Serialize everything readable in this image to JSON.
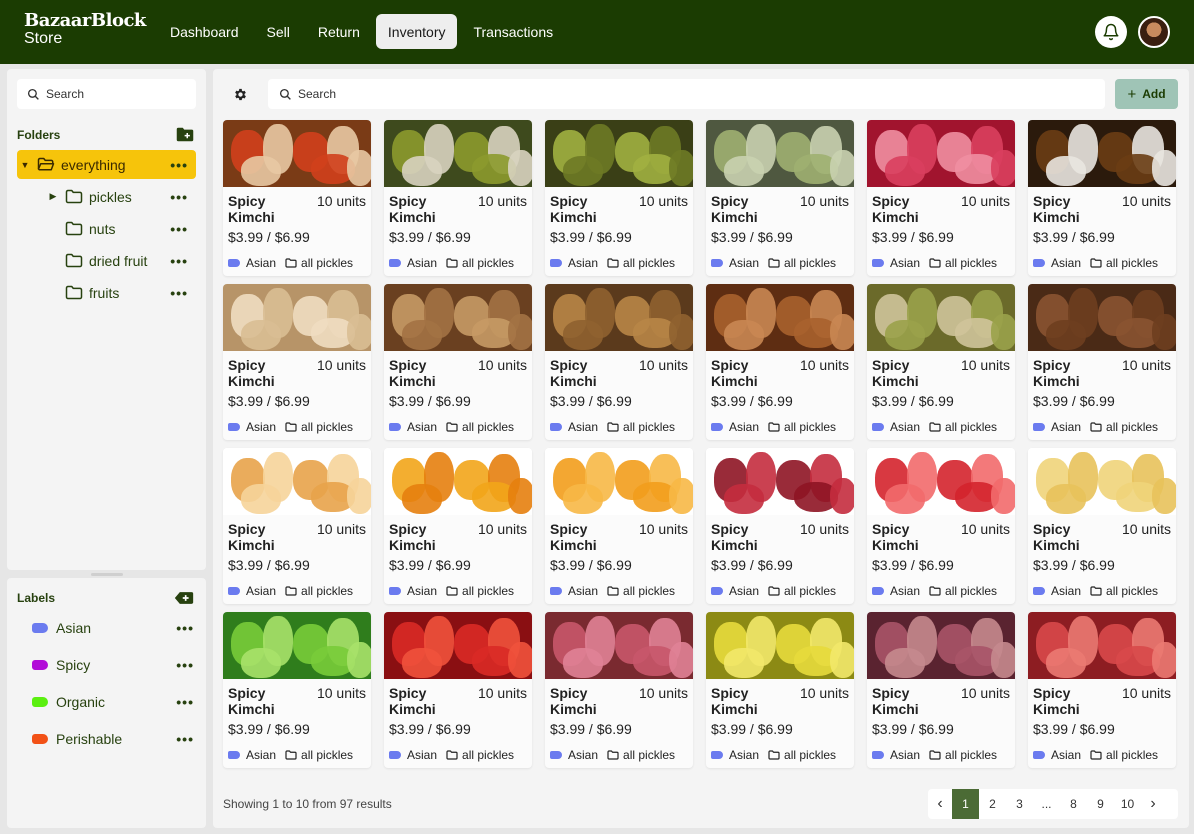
{
  "brand": {
    "line1": "BazaarBlock",
    "line2": "Store"
  },
  "nav": [
    {
      "label": "Dashboard",
      "active": false
    },
    {
      "label": "Sell",
      "active": false
    },
    {
      "label": "Return",
      "active": false
    },
    {
      "label": "Inventory",
      "active": true
    },
    {
      "label": "Transactions",
      "active": false
    }
  ],
  "sidebar": {
    "search_placeholder": "Search",
    "folders_title": "Folders",
    "folders": [
      {
        "label": "everything",
        "active": true,
        "caret": "▼"
      },
      {
        "label": "pickles",
        "active": false,
        "caret": "▶"
      },
      {
        "label": "nuts",
        "active": false,
        "caret": ""
      },
      {
        "label": "dried fruit",
        "active": false,
        "caret": ""
      },
      {
        "label": "fruits",
        "active": false,
        "caret": ""
      }
    ],
    "labels_title": "Labels",
    "labels": [
      {
        "label": "Asian",
        "color": "#6b7bef"
      },
      {
        "label": "Spicy",
        "color": "#b20bd8"
      },
      {
        "label": "Organic",
        "color": "#5bef10"
      },
      {
        "label": "Perishable",
        "color": "#f25116"
      }
    ],
    "more": "•••"
  },
  "main": {
    "search_placeholder": "Search",
    "add_label": "Add",
    "showing": "Showing 1 to 10 from 97 results"
  },
  "card_text": {
    "name": "Spicy Kimchi",
    "units": "10 units",
    "price": "$3.99 / $6.99",
    "label": "Asian",
    "folder": "all pickles"
  },
  "products": [
    {
      "thumb": [
        "#7a3b16",
        "#d0401c",
        "#e8c9a3"
      ]
    },
    {
      "thumb": [
        "#3e4a1d",
        "#8c9a2e",
        "#d8d3c0"
      ]
    },
    {
      "thumb": [
        "#3a3f16",
        "#a1b040",
        "#6e7a25"
      ]
    },
    {
      "thumb": [
        "#4f5840",
        "#9fb071",
        "#c9d1b0"
      ]
    },
    {
      "thumb": [
        "#a1142e",
        "#f08ea1",
        "#d93f5e"
      ]
    },
    {
      "thumb": [
        "#2b1a0c",
        "#6a3d14",
        "#e9e6e0"
      ]
    },
    {
      "thumb": [
        "#b79468",
        "#efddc1",
        "#d9be93"
      ]
    },
    {
      "thumb": [
        "#6a4020",
        "#c79a65",
        "#a37244"
      ]
    },
    {
      "thumb": [
        "#5b3a1c",
        "#b88647",
        "#8f6230"
      ]
    },
    {
      "thumb": [
        "#5e2d12",
        "#a8622e",
        "#c98753"
      ]
    },
    {
      "thumb": [
        "#6b6a2a",
        "#cfc49a",
        "#9aa24a"
      ]
    },
    {
      "thumb": [
        "#4a2a16",
        "#8a5331",
        "#6e3e1f"
      ]
    },
    {
      "thumb": [
        "#ffffff",
        "#e8a34a",
        "#f6d49a"
      ]
    },
    {
      "thumb": [
        "#ffffff",
        "#f2a51a",
        "#e67f0e"
      ]
    },
    {
      "thumb": [
        "#ffffff",
        "#f29d1c",
        "#f7b846"
      ]
    },
    {
      "thumb": [
        "#ffffff",
        "#8e1424",
        "#c42c3e"
      ]
    },
    {
      "thumb": [
        "#ffffff",
        "#d4242c",
        "#f26a6c"
      ]
    },
    {
      "thumb": [
        "#ffffff",
        "#f0d47a",
        "#e8c25b"
      ]
    },
    {
      "thumb": [
        "#2f7d1c",
        "#79cc3a",
        "#a9e26a"
      ]
    },
    {
      "thumb": [
        "#8a0f12",
        "#d92a26",
        "#f0523c"
      ]
    },
    {
      "thumb": [
        "#7a2a30",
        "#c8566a",
        "#e08296"
      ]
    },
    {
      "thumb": [
        "#8c8a14",
        "#e7da3c",
        "#f2e86a"
      ]
    },
    {
      "thumb": [
        "#5a2330",
        "#a85468",
        "#c58a8e"
      ]
    },
    {
      "thumb": [
        "#8d1d22",
        "#d8494a",
        "#eb7a72"
      ]
    }
  ],
  "pagination": {
    "prev": "‹",
    "pages": [
      "1",
      "2",
      "3",
      "...",
      "8",
      "9",
      "10"
    ],
    "current": "1",
    "next": "›"
  }
}
